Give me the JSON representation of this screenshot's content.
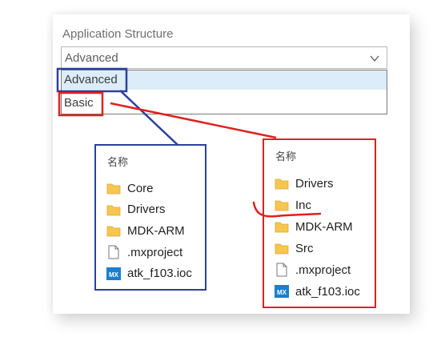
{
  "panel": {
    "label": "Application Structure",
    "selected": "Advanced",
    "options": [
      "Advanced",
      "Basic"
    ]
  },
  "advanced_box": {
    "header": "名称",
    "items": [
      {
        "name": "Core",
        "icon": "folder-icon"
      },
      {
        "name": "Drivers",
        "icon": "folder-icon"
      },
      {
        "name": "MDK-ARM",
        "icon": "folder-icon"
      },
      {
        "name": ".mxproject",
        "icon": "file-icon"
      },
      {
        "name": "atk_f103.ioc",
        "icon": "mx-icon"
      }
    ]
  },
  "basic_box": {
    "header": "名称",
    "items": [
      {
        "name": "Drivers",
        "icon": "folder-icon"
      },
      {
        "name": "Inc",
        "icon": "folder-icon"
      },
      {
        "name": "MDK-ARM",
        "icon": "folder-icon"
      },
      {
        "name": "Src",
        "icon": "folder-icon"
      },
      {
        "name": ".mxproject",
        "icon": "file-icon"
      },
      {
        "name": "atk_f103.ioc",
        "icon": "mx-icon"
      }
    ]
  },
  "icon_text": {
    "mx": "MX"
  },
  "colors": {
    "blue_annotation": "#2b3fa0",
    "red_annotation": "#e02020",
    "folder": "#f6c651",
    "mx_icon": "#1a7fd0",
    "selected_bg": "#dcecf8"
  }
}
